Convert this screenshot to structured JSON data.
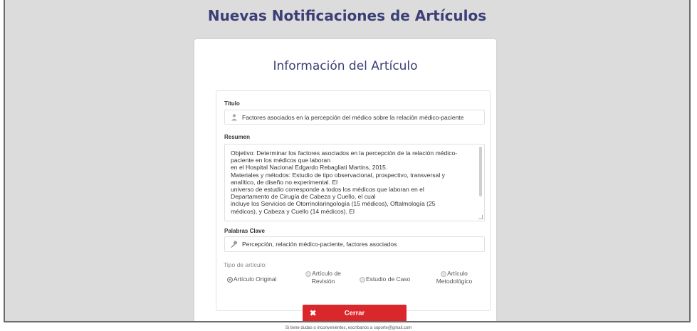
{
  "page": {
    "title": "Nuevas Notificaciones de Artículos"
  },
  "card": {
    "title": "Información del Artículo",
    "titulo": {
      "label": "Título",
      "value": "Factores asociados en la percepción del médico sobre la relación médico-paciente",
      "icon": "user-icon"
    },
    "resumen": {
      "label": "Resumen",
      "lines": [
        "Objetivo: Determinar los factores asociados en la percepción de la relación médico-",
        "paciente en los médicos que laboran",
        "en el Hospital Nacional Edgardo Rebagliati Martins, 2015.",
        "Materiales y métodos: Estudio de tipo observacional, prospectivo, transversal y",
        "analítico, de diseño no experimental. El",
        "universo de estudio corresponde a todos los médicos que laboran en el",
        "Departamento de Cirugía de Cabeza y Cuello, el cual",
        "incluye los Servicios de Otorrinolaringología (15 médicos), Oftalmología (25",
        "médicos), y Cabeza y Cuello (14 médicos). El"
      ]
    },
    "palabras": {
      "label": "Palabras Clave",
      "value": "Percepción, relación médico-paciente, factores asociados",
      "icon": "key-icon"
    },
    "tipo": {
      "label": "Tipo de artículo:",
      "options": [
        {
          "line1": "Artículo Original",
          "line2": "",
          "selected": true
        },
        {
          "line1": "Artículo de",
          "line2": "Revisión",
          "selected": false
        },
        {
          "line1": "Estudio de Caso",
          "line2": "",
          "selected": false
        },
        {
          "line1": "Artículo",
          "line2": "Metodológico",
          "selected": false
        }
      ]
    },
    "close_label": "Cerrar"
  },
  "footer": {
    "text": "Si tiene dudas o inconvenientes, escríbanos a soporte@gmail.com"
  },
  "colors": {
    "title": "#3c3f77",
    "danger": "#d9272c",
    "background": "#dcdcdc"
  }
}
